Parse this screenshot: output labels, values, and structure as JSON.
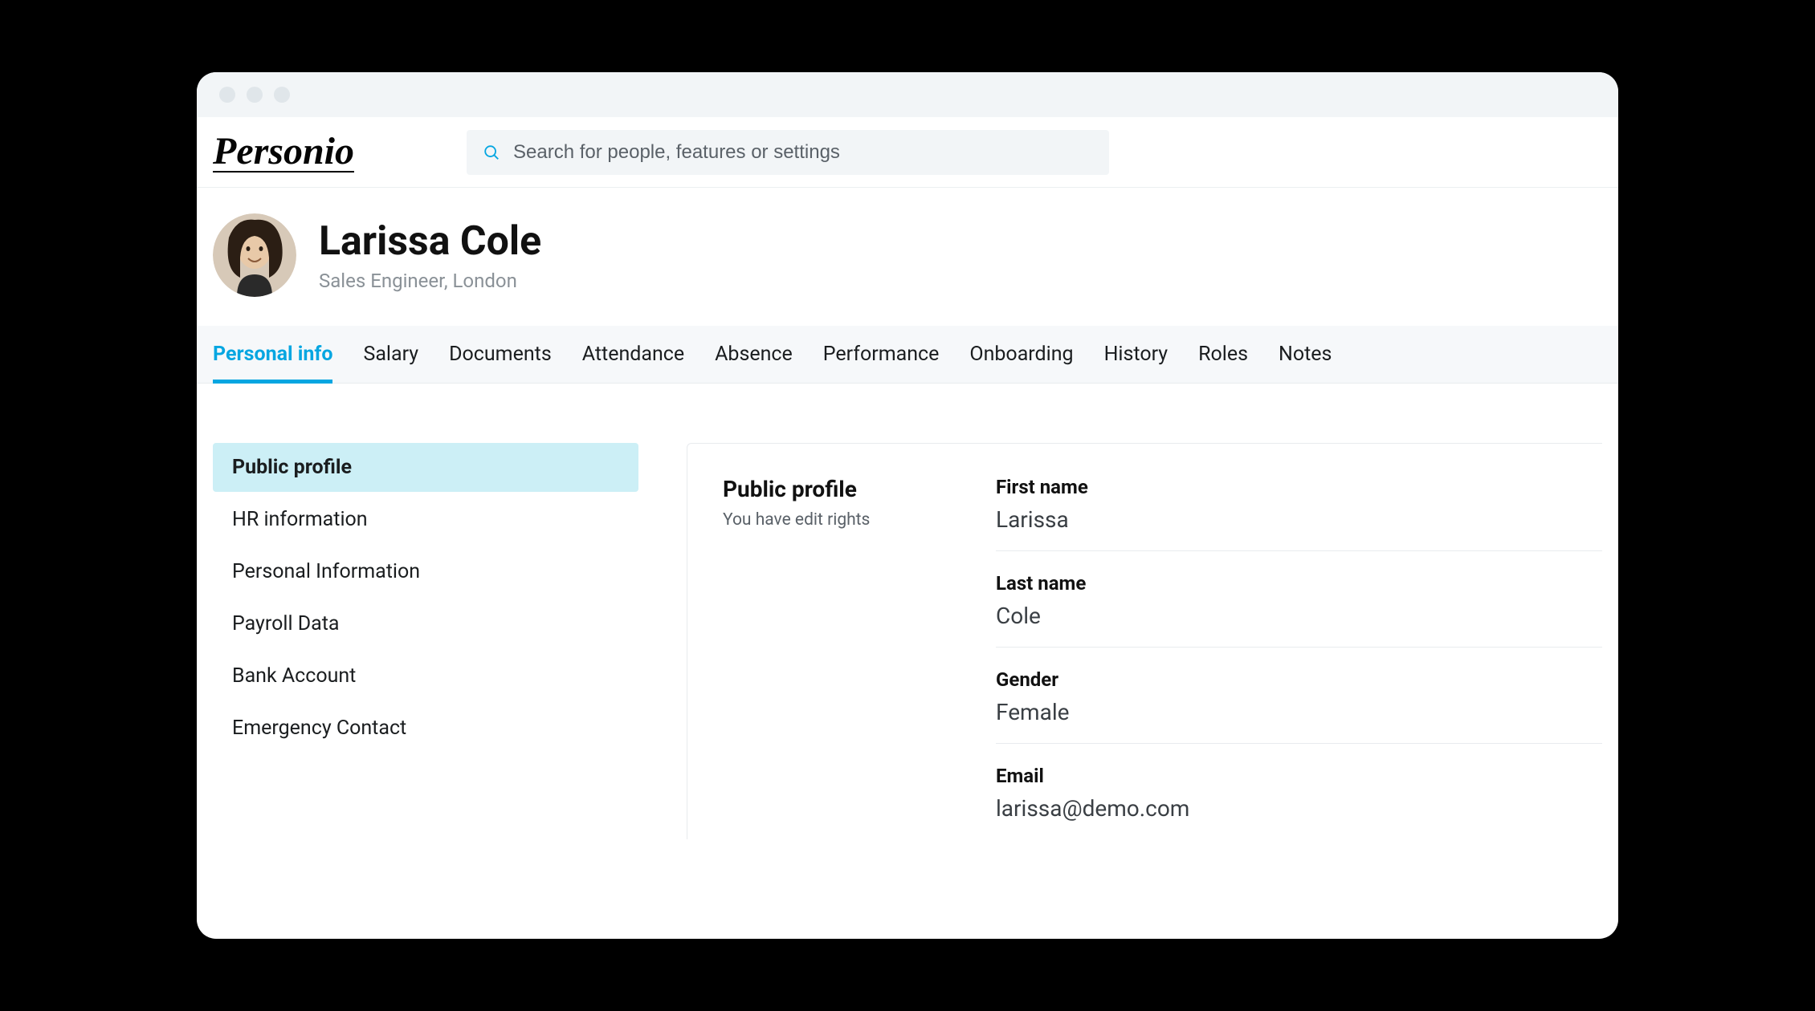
{
  "brand": "Personio",
  "search": {
    "placeholder": "Search for people, features or settings"
  },
  "profile": {
    "name": "Larissa Cole",
    "subtitle": "Sales Engineer, London"
  },
  "tabs": [
    {
      "label": "Personal info",
      "active": true
    },
    {
      "label": "Salary"
    },
    {
      "label": "Documents"
    },
    {
      "label": "Attendance"
    },
    {
      "label": "Absence"
    },
    {
      "label": "Performance"
    },
    {
      "label": "Onboarding"
    },
    {
      "label": "History"
    },
    {
      "label": "Roles"
    },
    {
      "label": "Notes"
    }
  ],
  "sidenav": [
    {
      "label": "Public profile",
      "active": true
    },
    {
      "label": "HR information"
    },
    {
      "label": "Personal Information"
    },
    {
      "label": "Payroll Data"
    },
    {
      "label": "Bank Account"
    },
    {
      "label": "Emergency Contact"
    }
  ],
  "panel": {
    "title": "Public profile",
    "subtitle": "You have edit rights",
    "fields": [
      {
        "label": "First name",
        "value": "Larissa"
      },
      {
        "label": "Last name",
        "value": "Cole"
      },
      {
        "label": "Gender",
        "value": "Female"
      },
      {
        "label": "Email",
        "value": "larissa@demo.com"
      }
    ]
  }
}
